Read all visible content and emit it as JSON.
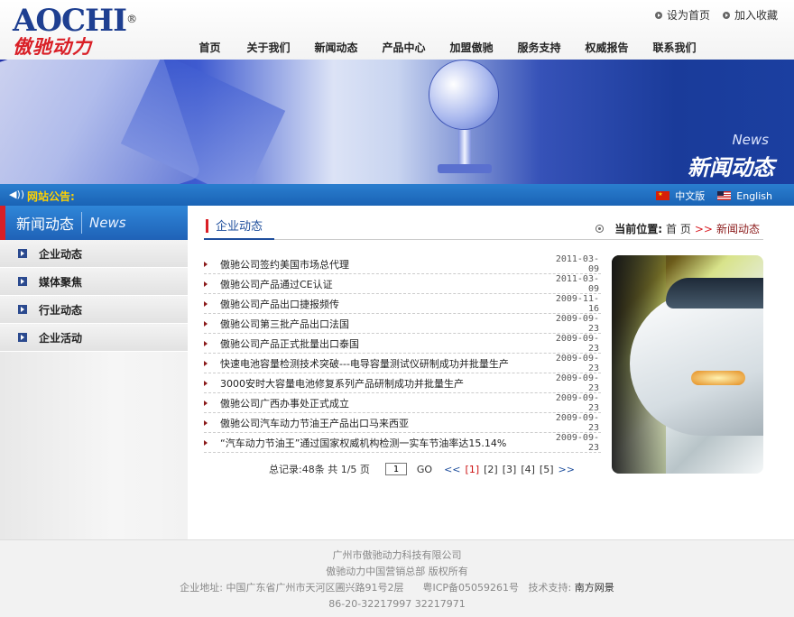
{
  "header": {
    "logo_en": "AOCHI",
    "logo_reg": "®",
    "logo_cn": "傲驰动力",
    "top_links": [
      {
        "label": "设为首页"
      },
      {
        "label": "加入收藏"
      }
    ],
    "nav": [
      {
        "label": "首页"
      },
      {
        "label": "关于我们"
      },
      {
        "label": "新闻动态"
      },
      {
        "label": "产品中心"
      },
      {
        "label": "加盟傲驰"
      },
      {
        "label": "服务支持"
      },
      {
        "label": "权威报告"
      },
      {
        "label": "联系我们"
      }
    ]
  },
  "banner": {
    "en": "News",
    "cn": "新闻动态"
  },
  "notice": {
    "title": "网站公告:",
    "lang_cn": "中文版",
    "lang_en": "English"
  },
  "sidebar": {
    "title_cn": "新闻动态",
    "title_en": "News",
    "items": [
      {
        "label": "企业动态"
      },
      {
        "label": "媒体聚焦"
      },
      {
        "label": "行业动态"
      },
      {
        "label": "企业活动"
      }
    ]
  },
  "main": {
    "title": "企业动态",
    "crumb_label": "当前位置:",
    "crumb_home": "首 页",
    "crumb_sep": ">>",
    "crumb_current": "新闻动态",
    "news": [
      {
        "title": "傲驰公司签约美国市场总代理",
        "date": "2011-03-09"
      },
      {
        "title": "傲驰公司产品通过CE认证",
        "date": "2011-03-09"
      },
      {
        "title": "傲驰公司产品出口捷报频传",
        "date": "2009-11-16"
      },
      {
        "title": "傲驰公司第三批产品出口法国",
        "date": "2009-09-23"
      },
      {
        "title": "傲驰公司产品正式批量出口泰国",
        "date": "2009-09-23"
      },
      {
        "title": "快速电池容量检测技术突破---电导容量测试仪研制成功并批量生产",
        "date": "2009-09-23"
      },
      {
        "title": "3000安时大容量电池修复系列产品研制成功并批量生产",
        "date": "2009-09-23"
      },
      {
        "title": "傲驰公司广西办事处正式成立",
        "date": "2009-09-23"
      },
      {
        "title": "傲驰公司汽车动力节油王产品出口马来西亚",
        "date": "2009-09-23"
      },
      {
        "title": "“汽车动力节油王”通过国家权威机构检测一实车节油率达15.14%",
        "date": "2009-09-23"
      }
    ],
    "pager": {
      "summary": "总记录:48条 共 1/5 页",
      "page_value": "1",
      "go": "GO",
      "prev": "<<",
      "next": ">>",
      "pages": [
        "[1]",
        "[2]",
        "[3]",
        "[4]",
        "[5]"
      ]
    }
  },
  "footer": {
    "company": "广州市傲驰动力科技有限公司",
    "rights": "傲驰动力中国营销总部 版权所有",
    "address": "企业地址: 中国广东省广州市天河区圃兴路91号2层",
    "icp": "粤ICP备05059261号",
    "support_label": "技术支持:",
    "support_name": "南方网景",
    "phones": "86-20-32217997 32217971"
  }
}
